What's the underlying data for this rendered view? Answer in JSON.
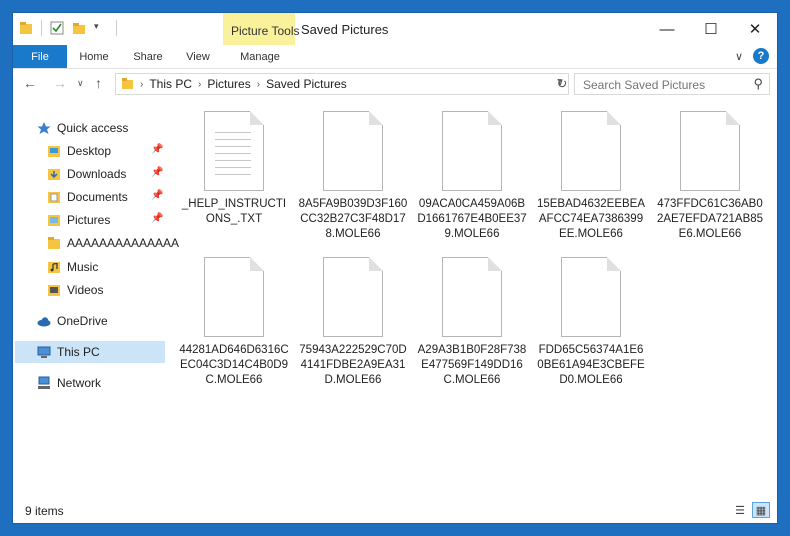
{
  "window": {
    "title": "Saved Pictures",
    "context_tab": "Picture Tools"
  },
  "ribbon": {
    "tabs": [
      "File",
      "Home",
      "Share",
      "View",
      "Manage"
    ]
  },
  "address": {
    "crumbs": [
      "This PC",
      "Pictures",
      "Saved Pictures"
    ],
    "search_placeholder": "Search Saved Pictures"
  },
  "nav": {
    "quick_access": "Quick access",
    "items": [
      {
        "label": "Desktop",
        "pinned": true
      },
      {
        "label": "Downloads",
        "pinned": true
      },
      {
        "label": "Documents",
        "pinned": true
      },
      {
        "label": "Pictures",
        "pinned": true
      },
      {
        "label": "AAAAAAAAAAAAAA",
        "pinned": false
      },
      {
        "label": "Music",
        "pinned": false
      },
      {
        "label": "Videos",
        "pinned": false
      }
    ],
    "onedrive": "OneDrive",
    "this_pc": "This PC",
    "network": "Network"
  },
  "files": [
    "_HELP_INSTRUCTIONS_.TXT",
    "8A5FA9B039D3F160CC32B27C3F48D178.MOLE66",
    "09ACA0CA459A06BD1661767E4B0EE379.MOLE66",
    "15EBAD4632EEBEAAFCC74EA7386399EE.MOLE66",
    "473FFDC61C36AB02AE7EFDA721AB85E6.MOLE66",
    "44281AD646D6316CEC04C3D14C4B0D9C.MOLE66",
    "75943A222529C70D4141FDBE2A9EA31D.MOLE66",
    "A29A3B1B0F28F738E477569F149DD16C.MOLE66",
    "FDD65C56374A1E60BE61A94E3CBEFED0.MOLE66"
  ],
  "status": {
    "count": "9 items"
  },
  "colors": {
    "accent": "#1979ca",
    "context_tab": "#f9f29b",
    "selection": "#cce4f7",
    "folder": "#f5c542"
  }
}
